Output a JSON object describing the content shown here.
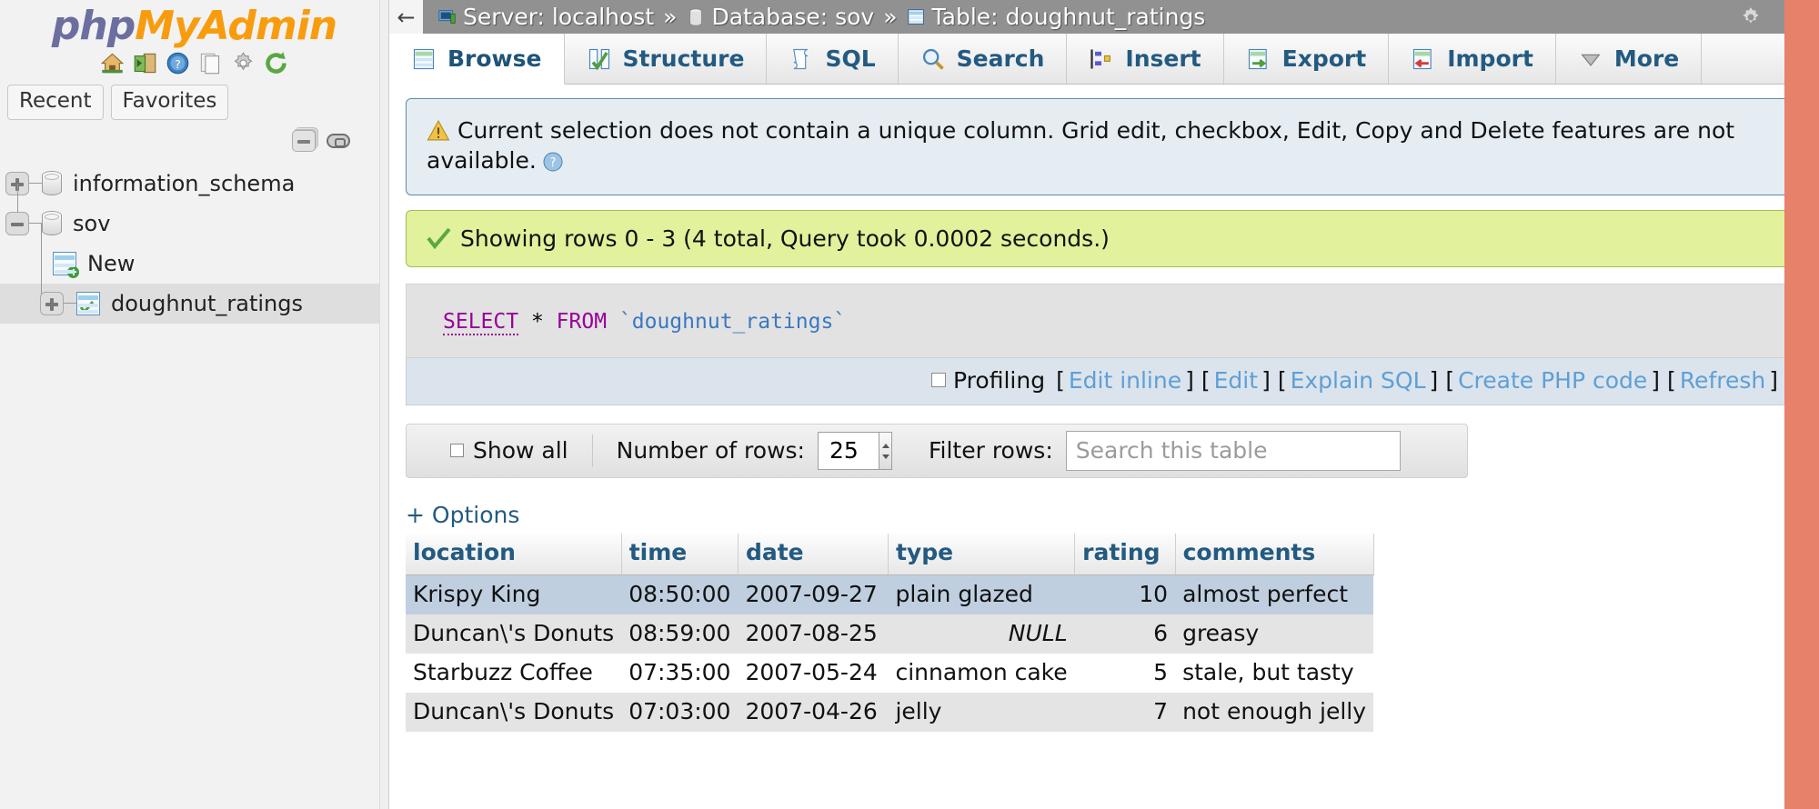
{
  "sidebar": {
    "logo": {
      "part1": "php",
      "part2": "My",
      "part3": "Admin"
    },
    "logo_icons": [
      {
        "name": "home-icon",
        "title": "Home"
      },
      {
        "name": "logout-icon",
        "title": "Log out"
      },
      {
        "name": "help-docs-icon",
        "title": "phpMyAdmin documentation"
      },
      {
        "name": "docs-icon",
        "title": "Documentation"
      },
      {
        "name": "settings-gear-icon",
        "title": "Settings"
      },
      {
        "name": "reload-icon",
        "title": "Reload navigation panel"
      }
    ],
    "tabs": [
      {
        "label": "Recent"
      },
      {
        "label": "Favorites"
      }
    ],
    "tree": [
      {
        "label": "information_schema",
        "type": "database",
        "state": "collapsed",
        "selected": false
      },
      {
        "label": "sov",
        "type": "database",
        "state": "expanded",
        "selected": false
      },
      {
        "label": "New",
        "type": "new-table",
        "state": "leaf",
        "selected": false
      },
      {
        "label": "doughnut_ratings",
        "type": "table",
        "state": "collapsed",
        "selected": true
      }
    ]
  },
  "topbar": {
    "back_glyph": "←",
    "breadcrumbs": [
      {
        "icon": "server-icon",
        "label": "Server: localhost"
      },
      {
        "icon": "database-icon",
        "label": "Database: sov"
      },
      {
        "icon": "table-icon",
        "label": "Table: doughnut_ratings"
      }
    ],
    "separator": "»",
    "gear_title": "Settings",
    "collapse_title": "Collapse"
  },
  "tabs": [
    {
      "label": "Browse",
      "icon": "browse-icon",
      "active": true
    },
    {
      "label": "Structure",
      "icon": "structure-icon",
      "active": false
    },
    {
      "label": "SQL",
      "icon": "sql-icon",
      "active": false
    },
    {
      "label": "Search",
      "icon": "search-icon",
      "active": false
    },
    {
      "label": "Insert",
      "icon": "insert-icon",
      "active": false
    },
    {
      "label": "Export",
      "icon": "export-icon",
      "active": false
    },
    {
      "label": "Import",
      "icon": "import-icon",
      "active": false
    },
    {
      "label": "More",
      "icon": "chevron-down-icon",
      "active": false
    }
  ],
  "warning": {
    "text": "Current selection does not contain a unique column. Grid edit, checkbox, Edit, Copy and Delete features are not available.",
    "icon": "warning-triangle-icon",
    "help_icon": "help-question-icon"
  },
  "success": {
    "text": "Showing rows 0 - 3 (4 total, Query took 0.0002 seconds.)",
    "icon": "green-check-icon"
  },
  "sql": {
    "keyword_select": "SELECT",
    "star": "*",
    "keyword_from": "FROM",
    "table_quoted": "`doughnut_ratings`"
  },
  "actions": {
    "profiling_label": "Profiling",
    "links": [
      {
        "label": "Edit inline"
      },
      {
        "label": "Edit"
      },
      {
        "label": "Explain SQL"
      },
      {
        "label": "Create PHP code"
      },
      {
        "label": "Refresh"
      }
    ],
    "bracket_open": "[",
    "bracket_close": "]"
  },
  "controls": {
    "show_all_label": "Show all",
    "number_of_rows_label": "Number of rows:",
    "number_of_rows_value": "25",
    "filter_rows_label": "Filter rows:",
    "filter_placeholder": "Search this table",
    "filter_value": ""
  },
  "options_link": "+ Options",
  "chart_data": {
    "type": "table",
    "title": "doughnut_ratings",
    "columns": [
      "location",
      "time",
      "date",
      "type",
      "rating",
      "comments"
    ],
    "rows": [
      {
        "location": "Krispy King",
        "time": "08:50:00",
        "date": "2007-09-27",
        "type": "plain glazed",
        "rating": "10",
        "comments": "almost perfect",
        "highlighted": true,
        "null_type": false
      },
      {
        "location": "Duncan\\'s Donuts",
        "time": "08:59:00",
        "date": "2007-08-25",
        "type": "NULL",
        "rating": "6",
        "comments": "greasy",
        "highlighted": false,
        "null_type": true
      },
      {
        "location": "Starbuzz Coffee",
        "time": "07:35:00",
        "date": "2007-05-24",
        "type": "cinnamon cake",
        "rating": "5",
        "comments": "stale, but tasty",
        "highlighted": false,
        "null_type": false
      },
      {
        "location": "Duncan\\'s Donuts",
        "time": "07:03:00",
        "date": "2007-04-26",
        "type": "jelly",
        "rating": "7",
        "comments": "not enough jelly",
        "highlighted": false,
        "null_type": false
      }
    ]
  },
  "colors": {
    "accent_blue": "#235a81",
    "link_blue": "#5f9fd6",
    "success_bg": "#e2f19b",
    "warning_bg": "#e5edf3",
    "highlight_row": "#bfcfe0",
    "logo_orange": "#f89c0e",
    "logo_purple": "#6c6ea0",
    "scrollbar": "#e8816a"
  }
}
